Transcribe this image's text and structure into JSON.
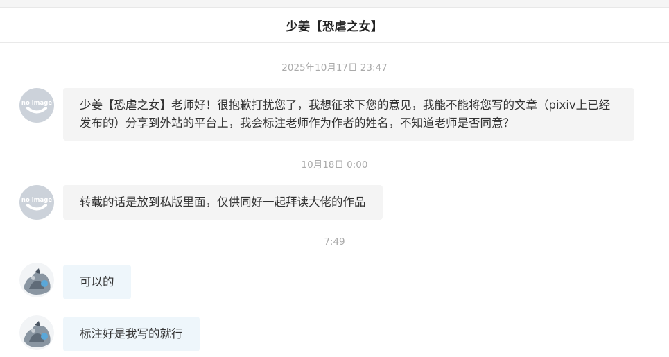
{
  "header": {
    "title": "少姜【恐虐之女】"
  },
  "messages": [
    {
      "time": "2025年10月17日 23:47",
      "avatar": "no-image-avatar",
      "text": "少姜【恐虐之女】老师好！很抱歉打扰您了，我想征求下您的意见，我能不能将您写的文章（pixiv上已经发布的）分享到外站的平台上，我会标注老师作为作者的姓名，不知道老师是否同意？"
    },
    {
      "time": "10月18日 0:00",
      "avatar": "no-image-avatar",
      "text": "转载的话是放到私版里面，仅供同好一起拜读大佬的作品"
    },
    {
      "time": "7:49",
      "avatar": "user-avatar",
      "text": "可以的"
    },
    {
      "time": "",
      "avatar": "user-avatar",
      "text": "标注好是我写的就行"
    }
  ],
  "avatar_placeholder_text": "no image",
  "colors": {
    "own_bubble": "#f4f4f4",
    "other_bubble": "#eef6fb",
    "timestamp": "#aaaaaa"
  }
}
